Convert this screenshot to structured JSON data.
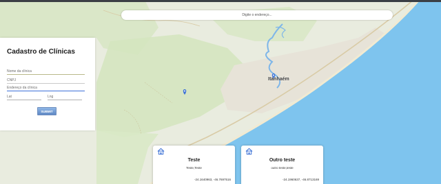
{
  "colors": {
    "land": "#e8ecde",
    "land_green": "#cfe3b6",
    "urban": "#e6e1d6",
    "water": "#7fc3ea",
    "road": "#d8c9a0",
    "river": "#7cb4e8",
    "accent": "#5f88c4"
  },
  "search": {
    "placeholder": "Digite o endereço..."
  },
  "form": {
    "title": "Cadastro de Clínicas",
    "name_placeholder": "Nome da clínica",
    "cnpj_placeholder": "CNPJ",
    "address_placeholder": "Endereço da clínica",
    "lat_placeholder": "Lat",
    "lng_placeholder": "Lng",
    "submit_label": "SUBMIT"
  },
  "map": {
    "city_label": "Itanhaém",
    "markers": [
      {
        "name": "marker-clinic-1",
        "icon": "map-pin-icon"
      },
      {
        "name": "marker-clinic-2",
        "icon": "map-pin-icon"
      }
    ]
  },
  "cards": [
    {
      "icon": "home-icon",
      "title": "Teste",
      "subtitle": "Teste,Teste",
      "coords": "-24.1640963, -46.7697516"
    },
    {
      "icon": "home-icon",
      "title": "Outro teste",
      "subtitle": "outro teste,teste",
      "coords": "-24.1960637, -46.8713169"
    }
  ]
}
